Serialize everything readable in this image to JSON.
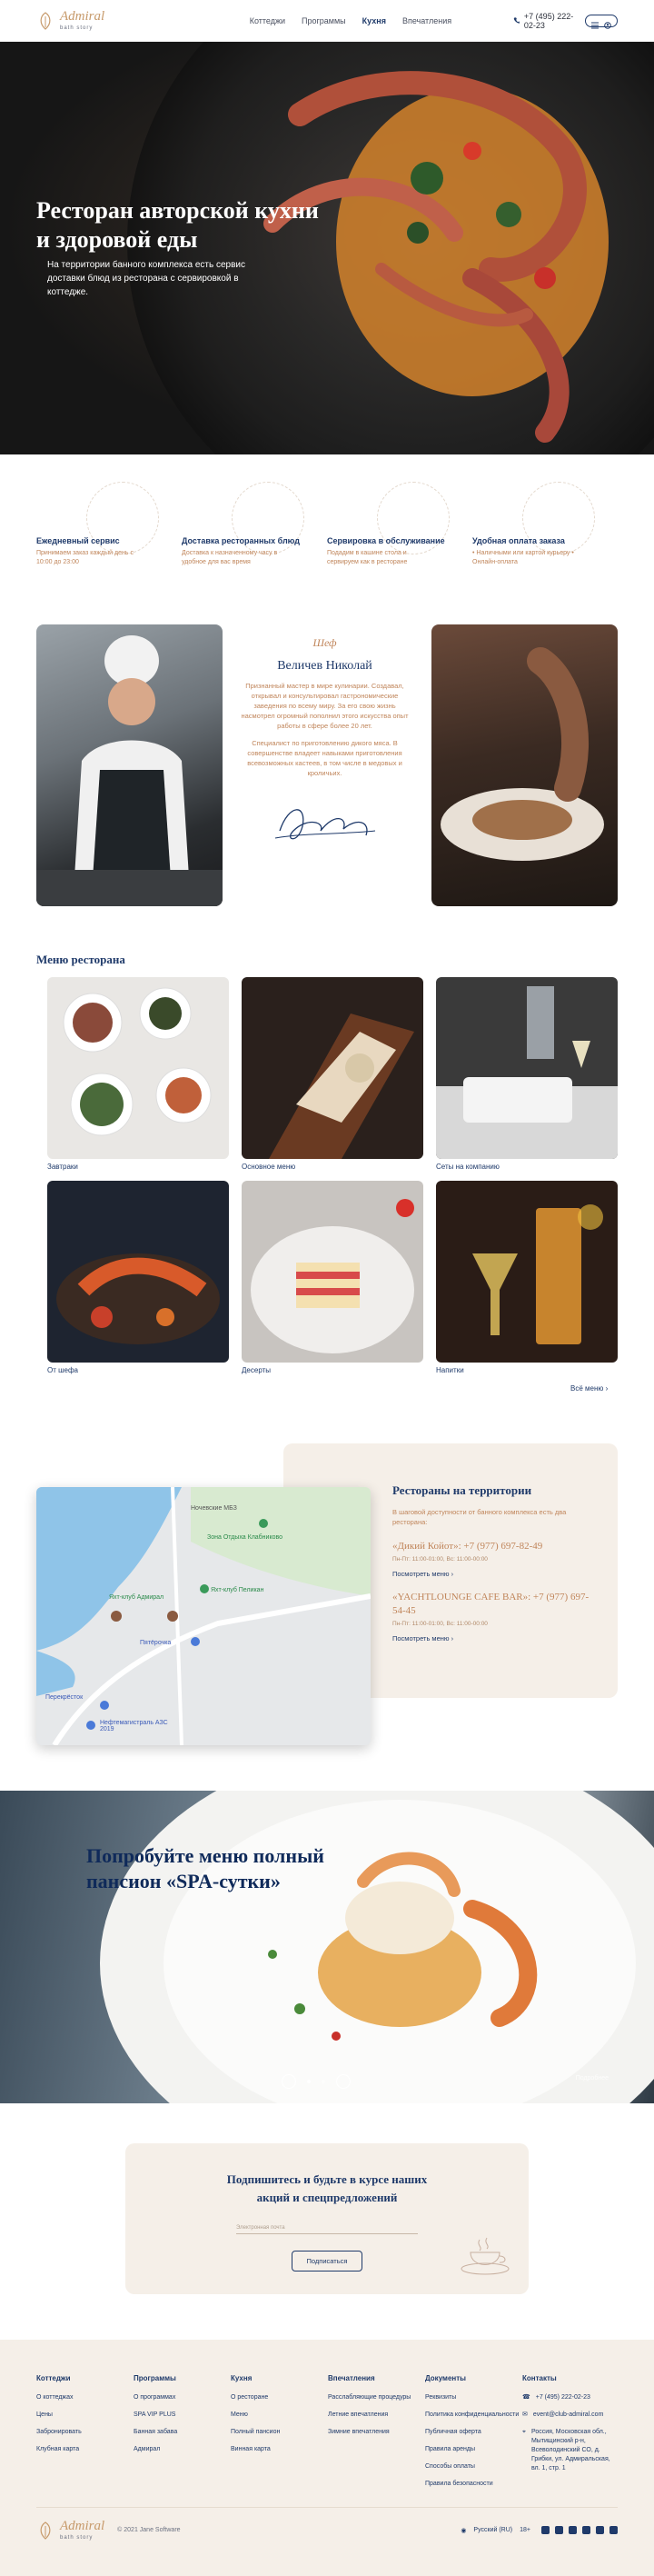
{
  "header": {
    "logo_name": "Admiral",
    "logo_sub": "bath story",
    "nav": [
      "Коттеджи",
      "Программы",
      "Кухня",
      "Впечатления"
    ],
    "active_nav": 2,
    "phone": "+7 (495) 222-02-23"
  },
  "hero": {
    "title": "Ресторан авторской кухни и здоровой еды",
    "subtitle": "На территории банного комплекса есть сервис доставки блюд из ресторана с сервировкой в коттедже."
  },
  "features": [
    {
      "title": "Ежедневный сервис",
      "text": "Принимаем заказ каждый день с 10:00 до 23:00"
    },
    {
      "title": "Доставка ресторанных блюд",
      "text": "Доставка к назначенному часу в удобное для вас время"
    },
    {
      "title": "Сервировка в обслуживание",
      "text": "Подадим в кашине стола и сервируем как в ресторане"
    },
    {
      "title": "Удобная оплата заказа",
      "text": "• Наличными или картой курьеру • Онлайн-оплата"
    }
  ],
  "chef": {
    "label": "Шеф",
    "name": "Величев Николай",
    "p1": "Признанный мастер в мире кулинарии. Создавал, открывал и консультировал гастрономические заведения по всему миру. За его свою жизнь насмотрел огромный пополнил этого искусства опыт работы в сфере более 20 лет.",
    "p2": "Специалист по приготовлению дикого мяса. В совершенстве владеет навыками приготовления всевозможных кастеев, в том числе в медовых и кроличьих."
  },
  "menu": {
    "title": "Меню ресторана",
    "items": [
      "Завтраки",
      "Основное меню",
      "Сеты на компанию",
      "От шефа",
      "Десерты",
      "Напитки"
    ],
    "all_label": "Всё меню"
  },
  "restaurants": {
    "title": "Рестораны на территории",
    "subtitle": "В шаговой доступности от банного комплекса есть два ресторана:",
    "more_label": "Посмотреть меню",
    "items": [
      {
        "name": "«Дикий Койот»: +7 (977) 697-82-49",
        "hours": "Пн-Пт: 11:00-01:00, Вс: 11:00-00:00"
      },
      {
        "name": "«YACHTLOUNGE CAFE BAR»: +7 (977) 697-54-45",
        "hours": "Пн-Пт: 11:00-01:00, Вс: 11:00-00:00"
      }
    ],
    "map_labels": [
      "Ночевские МБЗ",
      "Зона Отдыха Клабниково",
      "Яхт-клуб Адмирал",
      "Яхт-клуб Пеликан",
      "Пятёрочка",
      "Перекрёсток",
      "Нефтемагистраль АЗС 2019"
    ]
  },
  "spa": {
    "title": "Попробуйте меню полный пансион «SPA-сутки»",
    "corner_text": "Подробнее"
  },
  "subscribe": {
    "title": "Подпишитесь и будьте в курсе наших акций и спецпредложений",
    "placeholder": "Электронная почта",
    "button": "Подписаться"
  },
  "footer": {
    "columns": [
      {
        "title": "Коттеджи",
        "items": [
          "О коттеджах",
          "Цены",
          "Забронировать",
          "Клубная карта"
        ]
      },
      {
        "title": "Программы",
        "items": [
          "О программах",
          "SPA VIP PLUS",
          "Банная забава",
          "Адмирал"
        ]
      },
      {
        "title": "Кухня",
        "items": [
          "О ресторане",
          "Меню",
          "Полный пансион",
          "Винная карта"
        ]
      },
      {
        "title": "Впечатления",
        "items": [
          "Расслабляющие процедуры",
          "Летние впечатления",
          "Зимние впечатления"
        ]
      },
      {
        "title": "Документы",
        "items": [
          "Реквизиты",
          "Политика конфиденциальности",
          "Публичная оферта",
          "Правила аренды",
          "Способы оплаты",
          "Правила безопасности"
        ]
      }
    ],
    "contacts_title": "Контакты",
    "phone": "+7 (495) 222-02-23",
    "email": "event@club-admiral.com",
    "address": "Россия, Московская обл., Мытищинский р-н, Всеволодинский СО, д. Грибки, ул. Адмиральская, вл. 1, стр. 1",
    "copyright": "© 2021 Jane Software",
    "language": "Русский (RU)",
    "age": "18+"
  },
  "colors": {
    "navy": "#1f3a6a",
    "accent": "#c0855a",
    "beige": "#f5efe8"
  }
}
